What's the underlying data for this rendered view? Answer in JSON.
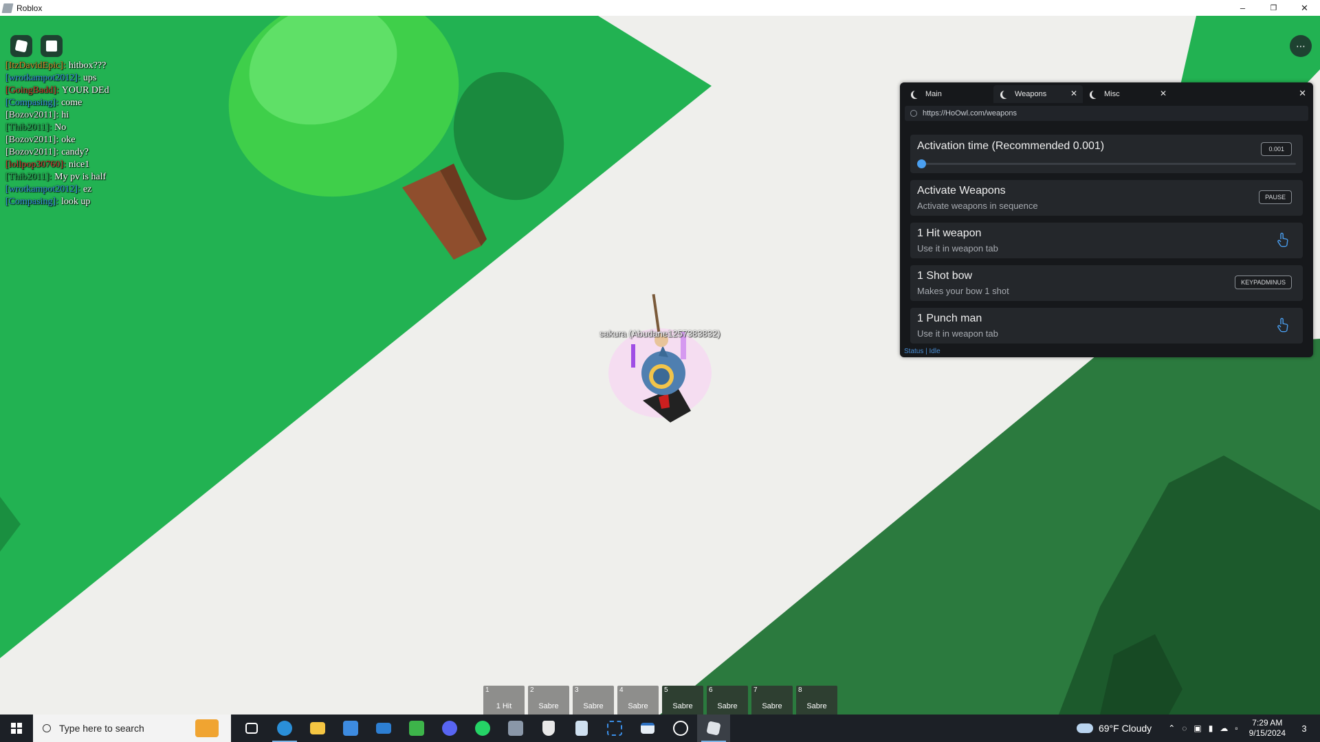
{
  "window": {
    "title": "Roblox",
    "minimize": "–",
    "restore": "❐",
    "close": "✕"
  },
  "chat": [
    {
      "name": "[ItzDavidEpic]:",
      "color": "#d28b2e",
      "text": "hitbox???"
    },
    {
      "name": "[wrotkampot2012]:",
      "color": "#3a8fe0",
      "text": "ups"
    },
    {
      "name": "[GoingBadd]:",
      "color": "#d03b32",
      "text": "YOUR DEd"
    },
    {
      "name": "[Compasing]:",
      "color": "#3a8fe0",
      "text": "come"
    },
    {
      "name": "[Bozov2011]:",
      "color": "#e9e9e9",
      "text": "hi"
    },
    {
      "name": "[Thib2011]:",
      "color": "#2fa85a",
      "text": "No"
    },
    {
      "name": "[Bozov2011]:",
      "color": "#e9e9e9",
      "text": "oke"
    },
    {
      "name": "[Bozov2011]:",
      "color": "#e9e9e9",
      "text": "candy?"
    },
    {
      "name": "[lollpop30760]:",
      "color": "#d03b32",
      "text": "nice1"
    },
    {
      "name": "[Thib2011]:",
      "color": "#2fa85a",
      "text": "My pv is half"
    },
    {
      "name": "[wrotkampot2012]:",
      "color": "#3a8fe0",
      "text": "ez"
    },
    {
      "name": "[Compasing]:",
      "color": "#3a8fe0",
      "text": "look up"
    }
  ],
  "character": {
    "nametag": "sakura (Abudane1257383832)"
  },
  "panel": {
    "tabs": [
      {
        "label": "Main",
        "closable": false,
        "active": false
      },
      {
        "label": "Weapons",
        "closable": true,
        "active": true
      },
      {
        "label": "Misc",
        "closable": true,
        "active": false
      }
    ],
    "tab_close_glyph": "✕",
    "close_glyph": "✕",
    "url": "https://HoOwl.com/weapons",
    "rows": [
      {
        "title": "Activation time (Recommended 0.001)",
        "button": "0.001",
        "slider_value": 0
      },
      {
        "title": "Activate Weapons",
        "subtitle": "Activate weapons in sequence",
        "button": "PAUSE"
      },
      {
        "title": "1 Hit weapon",
        "subtitle": "Use it in weapon tab",
        "icon": "touch-icon"
      },
      {
        "title": "1 Shot bow",
        "subtitle": "Makes your bow 1 shot",
        "button": "KEYPADMINUS"
      },
      {
        "title": "1 Punch man",
        "subtitle": "Use it in weapon tab",
        "icon": "touch-icon"
      }
    ],
    "status": "Status | Idle"
  },
  "hotbar": [
    {
      "num": "1",
      "label": "1 Hit"
    },
    {
      "num": "2",
      "label": "Sabre"
    },
    {
      "num": "3",
      "label": "Sabre"
    },
    {
      "num": "4",
      "label": "Sabre"
    },
    {
      "num": "5",
      "label": "Sabre"
    },
    {
      "num": "6",
      "label": "Sabre"
    },
    {
      "num": "7",
      "label": "Sabre"
    },
    {
      "num": "8",
      "label": "Sabre"
    }
  ],
  "taskbar": {
    "search_placeholder": "Type here to search",
    "weather": "69°F  Cloudy",
    "time": "7:29 AM",
    "date": "9/15/2024",
    "notifications": "3"
  },
  "colors": {
    "grass": "#22b252",
    "ground": "#efefec",
    "panel_bg": "#16181b",
    "accent": "#4a9ff0"
  }
}
